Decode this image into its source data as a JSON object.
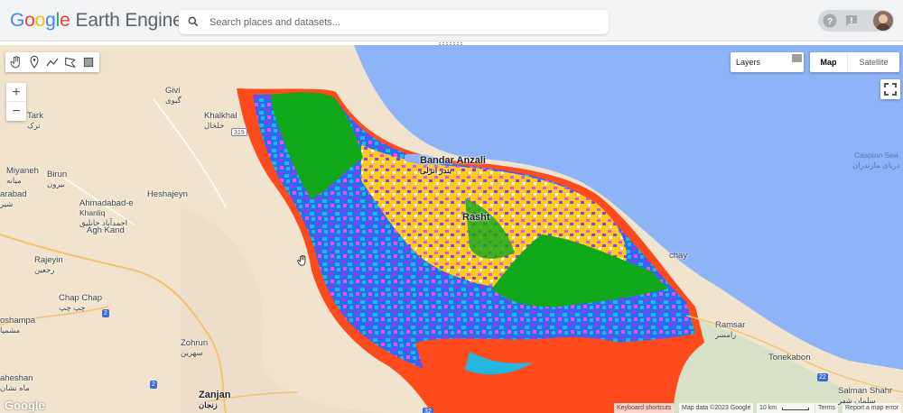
{
  "app": {
    "logo_google": [
      "G",
      "o",
      "o",
      "g",
      "l",
      "e"
    ],
    "logo_product": "Earth Engine"
  },
  "search": {
    "placeholder": "Search places and datasets..."
  },
  "header_icons": [
    "help-icon",
    "feedback-icon",
    "avatar"
  ],
  "map_controls": {
    "layers_label": "Layers",
    "map_type_options": [
      "Map",
      "Satellite"
    ],
    "map_type_selected": "Map",
    "zoom_in": "+",
    "zoom_out": "−",
    "drawing_tools": [
      "hand-icon",
      "point-icon",
      "line-icon",
      "polygon-icon",
      "rectangle-icon"
    ]
  },
  "map_labels": {
    "tark": "Tark",
    "tark_fa": "ترک",
    "givi": "Givi",
    "givi_fa": "گیوی",
    "khalkhal": "Khalkhal",
    "khalkhal_fa": "خلخال",
    "miyaneh": "Miyaneh",
    "miyaneh_fa": "میانه",
    "birun": "Birun",
    "birun_fa": "بیرون",
    "arabad": "arabad",
    "arabad_fa": "شیر",
    "ahmadabad": "Ahmadabad-e",
    "ahmadabad2": "Khanliq",
    "ahmadabad_fa": "احمدآباد خانلیق",
    "heshajeyn": "Heshajeyn",
    "agh_kand": "Agh Kand",
    "rajeyin": "Rajeyin",
    "rajeyin_fa": "رجعین",
    "chap_chap": "Chap Chap",
    "chap_chap_fa": "چپ چپ",
    "oshampa": "oshampa",
    "oshampa_fa": "مشمپا",
    "zohrun": "Zohrun",
    "zohrun_fa": "سهرین",
    "maheshan": "aheshan",
    "maheshan_fa": "ماه نشان",
    "zanjan": "Zanjan",
    "zanjan_fa": "زنجان",
    "bandar_anzali": "Bandar Anzali",
    "bandar_anzali_fa": "بندر انزلی",
    "rasht": "Rasht",
    "chay": "chay",
    "ramsar": "Ramsar",
    "ramsar_fa": "رامسر",
    "tonekabon": "Tonekabon",
    "salman_shahr": "Salman Shahr",
    "salman_shahr_fa": "سلمان شهر",
    "caspian_sea": "Caspian Sea",
    "caspian_sea_fa": "دریای مازندران",
    "road_319": "319",
    "road_2a": "2",
    "road_2b": "2",
    "road_22": "22",
    "road_32": "32"
  },
  "attribution": {
    "google": "Google",
    "keyboard": "Keyboard shortcuts",
    "map_data": "Map data ©2023 Google",
    "scale": "10 km",
    "terms": "Terms",
    "report": "Report a map error"
  },
  "colors": {
    "sea": "#8db4f6",
    "land": "#f1e4cf",
    "class_red": "#ff4a1c",
    "class_green": "#10a818",
    "class_blue": "#2a6cf0",
    "class_cyan": "#23b6e0",
    "class_purple": "#8a3cf0",
    "class_magenta": "#e84ef0",
    "class_yellow": "#ffcc1a"
  }
}
